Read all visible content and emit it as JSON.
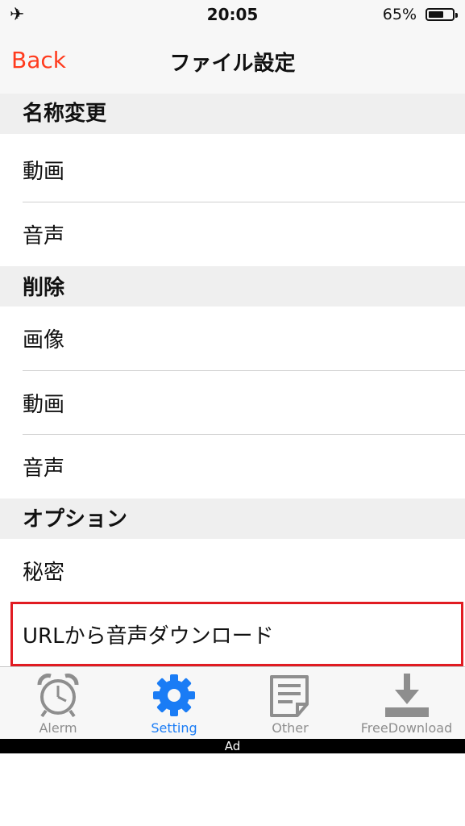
{
  "status": {
    "time": "20:05",
    "battery_pct": "65%",
    "battery_level": 0.65,
    "airplane_icon": "✈"
  },
  "nav": {
    "back_label": "Back",
    "title": "ファイル設定"
  },
  "sections": [
    {
      "header": "名称変更",
      "items": [
        "動画",
        "音声"
      ]
    },
    {
      "header": "削除",
      "items": [
        "画像",
        "動画",
        "音声"
      ]
    },
    {
      "header": "オプション",
      "items": [
        "秘密",
        "URLから音声ダウンロード"
      ]
    }
  ],
  "tabs": [
    {
      "label": "Alerm",
      "icon": "alarm-clock-icon"
    },
    {
      "label": "Setting",
      "icon": "gear-icon"
    },
    {
      "label": "Other",
      "icon": "note-icon"
    },
    {
      "label": "FreeDownload",
      "icon": "download-icon"
    }
  ],
  "ad": {
    "label": "Ad"
  },
  "colors": {
    "accent_back": "#ff3b1e",
    "tab_active": "#1a7cf5",
    "tab_inactive": "#8e8e8e",
    "highlight": "#e11b22"
  }
}
